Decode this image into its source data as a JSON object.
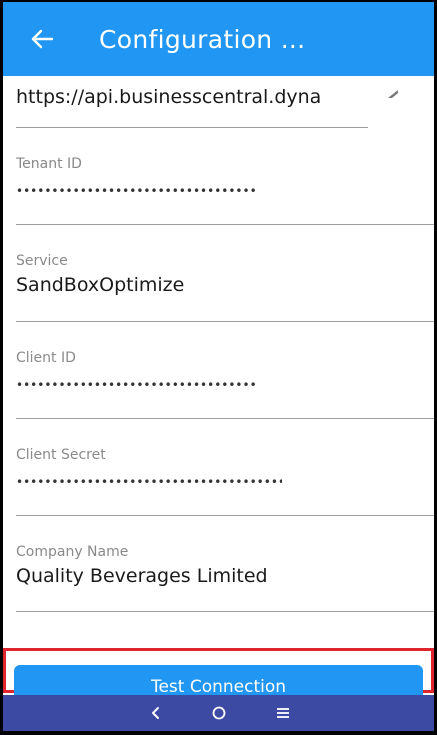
{
  "app_bar": {
    "title": "Configuration ...",
    "back_icon": "arrow-left-icon",
    "color": "#2196f3"
  },
  "form": {
    "api_url": {
      "value": "https://api.businesscentral.dyna"
    },
    "tenant_id": {
      "label": "Tenant ID",
      "value": "••••••••••••••••••••••••••••••••••"
    },
    "service": {
      "label": "Service",
      "value": "SandBoxOptimize"
    },
    "client_id": {
      "label": "Client ID",
      "value": "••••••••••••••••••••••••••••••••••"
    },
    "client_secret": {
      "label": "Client Secret",
      "value": "••••••••••••••••••••••••••••••••••••••"
    },
    "company_name": {
      "label": "Company Name",
      "value": "Quality Beverages Limited"
    }
  },
  "actions": {
    "test_connection_label": "Test Connection",
    "highlight_color": "#e0242d"
  },
  "nav_bar": {
    "back_icon": "nav-back-icon",
    "home_icon": "nav-home-icon",
    "menu_icon": "nav-menu-icon",
    "color": "#3d4aa3"
  }
}
